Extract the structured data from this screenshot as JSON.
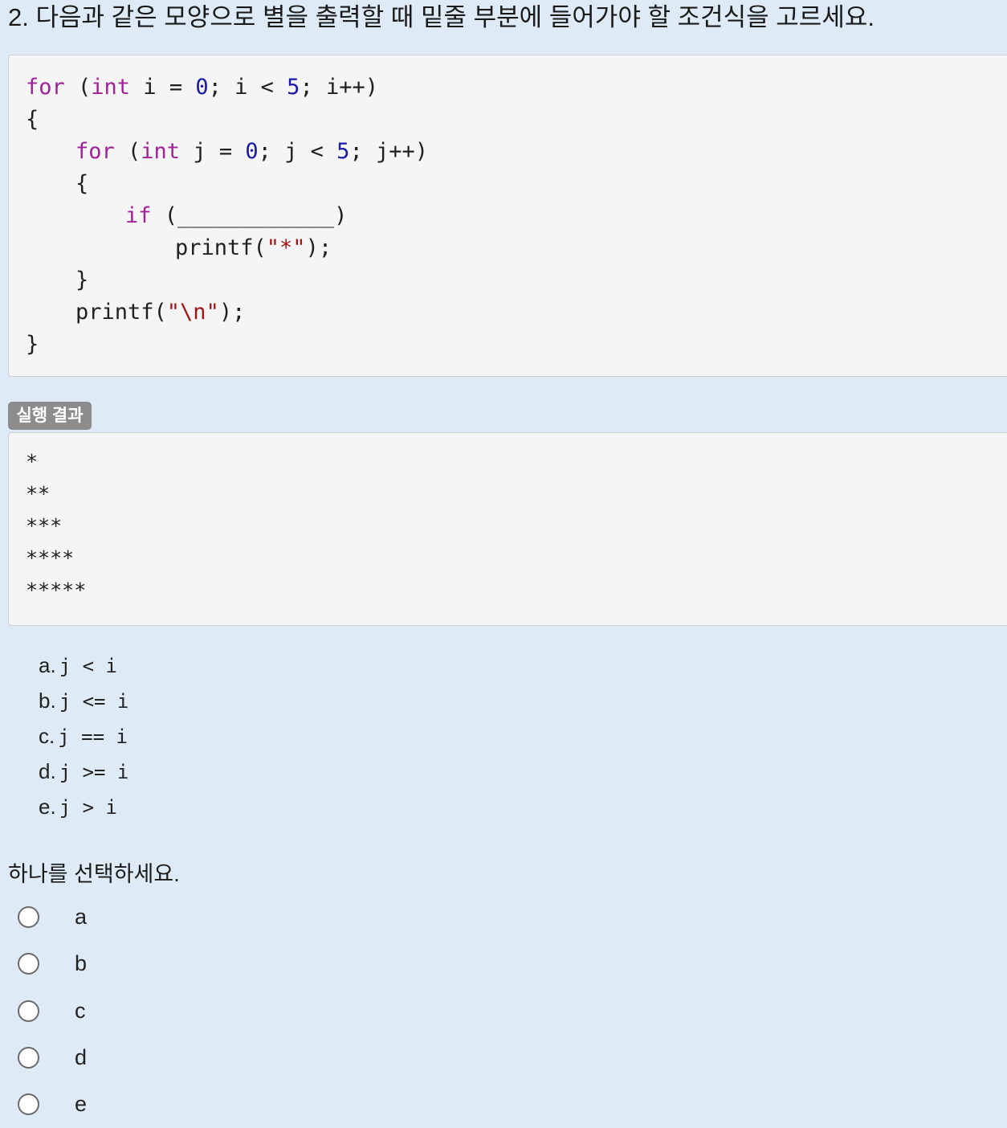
{
  "question": {
    "title": "2. 다음과 같은 모양으로 별을 출력할 때 밑줄 부분에 들어가야 할 조건식을 고르세요."
  },
  "code": {
    "outer_for_kw": "for",
    "outer_for_open": " (",
    "outer_int_kw": "int",
    "outer_init_a": " i = ",
    "outer_zero": "0",
    "outer_mid": "; i < ",
    "outer_five": "5",
    "outer_end": "; i++)",
    "outer_open_brace": "{",
    "inner_for_kw": "for",
    "inner_for_open": " (",
    "inner_int_kw": "int",
    "inner_init_a": " j = ",
    "inner_zero": "0",
    "inner_mid": "; j < ",
    "inner_five": "5",
    "inner_end": "; j++)",
    "inner_open_brace": "{",
    "if_kw": "if",
    "if_blank": " (____________)",
    "printf_star_a": "printf(",
    "printf_star_str": "\"*\"",
    "printf_star_b": ");",
    "inner_close_brace": "}",
    "printf_nl_a": "printf(",
    "printf_nl_str": "\"\\n\"",
    "printf_nl_b": ");",
    "outer_close_brace": "}"
  },
  "result": {
    "badge": "실행 결과",
    "lines": [
      "*",
      "**",
      "***",
      "****",
      "*****"
    ]
  },
  "answers": [
    {
      "letter": "a.",
      "expr": "j < i"
    },
    {
      "letter": "b.",
      "expr": "j <= i"
    },
    {
      "letter": "c.",
      "expr": "j == i"
    },
    {
      "letter": "d.",
      "expr": "j >= i"
    },
    {
      "letter": "e.",
      "expr": "j > i"
    }
  ],
  "selection": {
    "prompt": "하나를 선택하세요.",
    "options": [
      "a",
      "b",
      "c",
      "d",
      "e"
    ]
  }
}
